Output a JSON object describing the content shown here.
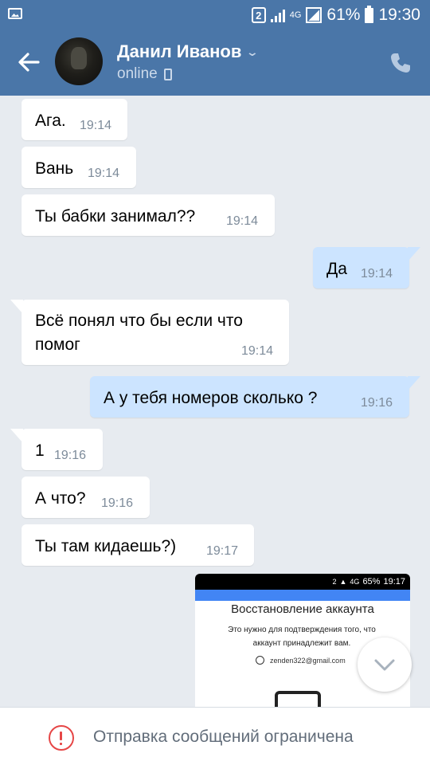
{
  "status_bar": {
    "sim": "2",
    "network": "4G",
    "battery": "61%",
    "time": "19:30"
  },
  "header": {
    "contact_name": "Данил Иванов",
    "contact_status": "online",
    "colors": {
      "bar": "#4a76a8"
    }
  },
  "messages": [
    {
      "direction": "in",
      "text": "Ага.",
      "time": "19:14"
    },
    {
      "direction": "in",
      "text": "Вань",
      "time": "19:14"
    },
    {
      "direction": "in",
      "text": "Ты бабки занимал??",
      "time": "19:14"
    },
    {
      "direction": "out",
      "text": "Да",
      "time": "19:14"
    },
    {
      "direction": "in",
      "text_lines": [
        "Всё понял что бы если что",
        "помог"
      ],
      "time": "19:14"
    },
    {
      "direction": "out",
      "text": "А у тебя номеров сколько ?",
      "time": "19:16"
    },
    {
      "direction": "in",
      "text": "1",
      "time": "19:16"
    },
    {
      "direction": "in",
      "text": "А что?",
      "time": "19:16"
    },
    {
      "direction": "in",
      "text": "Ты там кидаешь?)",
      "time": "19:17"
    }
  ],
  "attachment": {
    "status_sim": "2",
    "status_net": "4G",
    "status_battery": "65%",
    "status_time": "19:17",
    "title": "Восстановление аккаунта",
    "text_lines": [
      "Это нужно для подтверждения того, что",
      "аккаунт принадлежит вам."
    ],
    "email": "zenden322@gmail.com"
  },
  "footer": {
    "notice": "Отправка сообщений ограничена",
    "colors": {
      "warning": "#e64646"
    }
  }
}
